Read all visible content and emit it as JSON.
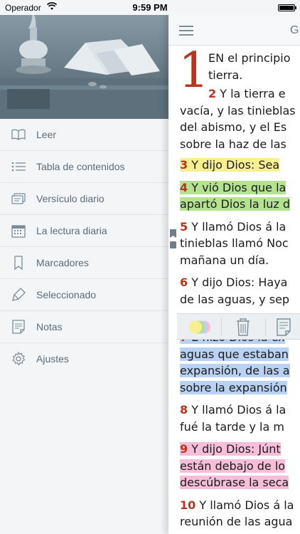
{
  "status_bar": {
    "carrier": "Operador",
    "time": "9:59 PM"
  },
  "menu": [
    {
      "label": "Leer",
      "icon": "open-book-icon"
    },
    {
      "label": "Tabla de contenidos",
      "icon": "list-icon"
    },
    {
      "label": "Versículo diario",
      "icon": "cards-icon"
    },
    {
      "label": "La lectura diaria",
      "icon": "calendar-icon"
    },
    {
      "label": "Marcadores",
      "icon": "bookmark-icon"
    },
    {
      "label": "Seleccionado",
      "icon": "highlighter-icon"
    },
    {
      "label": "Notas",
      "icon": "note-icon"
    },
    {
      "label": "Ajustes",
      "icon": "gear-icon"
    }
  ],
  "reader": {
    "title": "G",
    "dropcap": "1",
    "verses": {
      "v1": {
        "lines": [
          "EN el principio",
          "tierra."
        ]
      },
      "v2": {
        "num": "2",
        "lines": [
          " Y la tierra e",
          "vacía, y las tinieblas",
          "del abismo, y el Es",
          "sobre la haz de las"
        ]
      },
      "v3": {
        "num": "3",
        "lines": [
          " Y dijo Dios: Sea"
        ]
      },
      "v4": {
        "num": "4",
        "lines": [
          " Y vió Dios que la",
          "apartó Dios la luz d"
        ]
      },
      "v5": {
        "num": "5",
        "lines": [
          " Y llamó Dios á la",
          "tinieblas llamó Noc",
          "mañana un día."
        ]
      },
      "v6": {
        "num": "6",
        "lines": [
          " Y dijo Dios: Haya",
          "de las aguas, y sep"
        ]
      },
      "v7": {
        "num": "7",
        "lines": [
          " E hizo Dios la ex",
          "aguas que estaban",
          "expansión, de las a",
          "sobre la expansión"
        ]
      },
      "v8": {
        "num": "8",
        "lines": [
          " Y llamó Dios á la",
          "fué la tarde y la m"
        ]
      },
      "v9": {
        "num": "9",
        "lines": [
          " Y dijo Dios: Júnt",
          "están debajo de lo",
          "descúbrase la seca"
        ]
      },
      "v10": {
        "num": "10",
        "lines": [
          " Y llamó Dios á la",
          "reunión de las agua"
        ]
      }
    }
  },
  "colors": {
    "accent_red": "#b8341f",
    "highlight_yellow": "#f7ef90",
    "highlight_green": "#b3e390",
    "highlight_blue": "#b9d2f3",
    "highlight_pink": "#f7bdd9"
  }
}
